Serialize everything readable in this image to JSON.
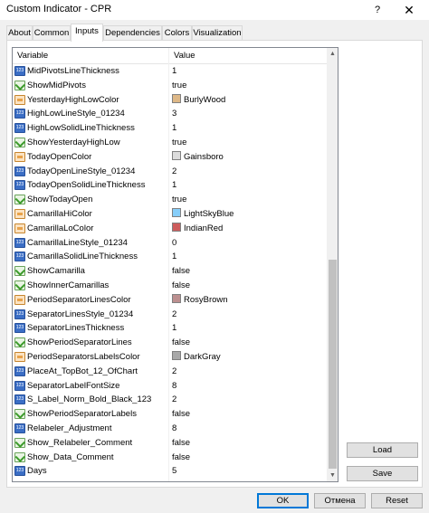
{
  "window": {
    "title": "Custom Indicator - CPR",
    "help_label": "?",
    "close_label": "✕"
  },
  "tabs": [
    {
      "label": "About"
    },
    {
      "label": "Common"
    },
    {
      "label": "Inputs",
      "active": true
    },
    {
      "label": "Dependencies"
    },
    {
      "label": "Colors"
    },
    {
      "label": "Visualization"
    }
  ],
  "grid": {
    "columns": [
      "Variable",
      "Value"
    ],
    "rows": [
      {
        "icon": "num-icon",
        "name": "MidPivotsLineThickness",
        "value": "1"
      },
      {
        "icon": "bool-icon",
        "name": "ShowMidPivots",
        "value": "true"
      },
      {
        "icon": "color-icon",
        "name": "YesterdayHighLowColor",
        "value": "BurlyWood",
        "swatch": "#deb887"
      },
      {
        "icon": "num-icon",
        "name": "HighLowLineStyle_01234",
        "value": "3"
      },
      {
        "icon": "num-icon",
        "name": "HighLowSolidLineThickness",
        "value": "1"
      },
      {
        "icon": "bool-icon",
        "name": "ShowYesterdayHighLow",
        "value": "true"
      },
      {
        "icon": "color-icon",
        "name": "TodayOpenColor",
        "value": "Gainsboro",
        "swatch": "#dcdcdc"
      },
      {
        "icon": "num-icon",
        "name": "TodayOpenLineStyle_01234",
        "value": "2"
      },
      {
        "icon": "num-icon",
        "name": "TodayOpenSolidLineThickness",
        "value": "1"
      },
      {
        "icon": "bool-icon",
        "name": "ShowTodayOpen",
        "value": "true"
      },
      {
        "icon": "color-icon",
        "name": "CamarillaHiColor",
        "value": "LightSkyBlue",
        "swatch": "#87cefa"
      },
      {
        "icon": "color-icon",
        "name": "CamarillaLoColor",
        "value": "IndianRed",
        "swatch": "#cd5c5c"
      },
      {
        "icon": "num-icon",
        "name": "CamarillaLineStyle_01234",
        "value": "0"
      },
      {
        "icon": "num-icon",
        "name": "CamarillaSolidLineThickness",
        "value": "1"
      },
      {
        "icon": "bool-icon",
        "name": "ShowCamarilla",
        "value": "false"
      },
      {
        "icon": "bool-icon",
        "name": "ShowInnerCamarillas",
        "value": "false"
      },
      {
        "icon": "color-icon",
        "name": "PeriodSeparatorLinesColor",
        "value": "RosyBrown",
        "swatch": "#bc8f8f"
      },
      {
        "icon": "num-icon",
        "name": "SeparatorLinesStyle_01234",
        "value": "2"
      },
      {
        "icon": "num-icon",
        "name": "SeparatorLinesThickness",
        "value": "1"
      },
      {
        "icon": "bool-icon",
        "name": "ShowPeriodSeparatorLines",
        "value": "false"
      },
      {
        "icon": "color-icon",
        "name": "PeriodSeparatorsLabelsColor",
        "value": "DarkGray",
        "swatch": "#a9a9a9"
      },
      {
        "icon": "num-icon",
        "name": "PlaceAt_TopBot_12_OfChart",
        "value": "2"
      },
      {
        "icon": "num-icon",
        "name": "SeparatorLabelFontSize",
        "value": "8"
      },
      {
        "icon": "num-icon",
        "name": "S_Label_Norm_Bold_Black_123",
        "value": "2"
      },
      {
        "icon": "bool-icon",
        "name": "ShowPeriodSeparatorLabels",
        "value": "false"
      },
      {
        "icon": "num-icon",
        "name": "Relabeler_Adjustment",
        "value": "8"
      },
      {
        "icon": "bool-icon",
        "name": "Show_Relabeler_Comment",
        "value": "false"
      },
      {
        "icon": "bool-icon",
        "name": "Show_Data_Comment",
        "value": "false"
      },
      {
        "icon": "num-icon",
        "name": "Days",
        "value": "5"
      }
    ]
  },
  "buttons": {
    "load": "Load",
    "save": "Save",
    "ok": "OK",
    "cancel": "Отмена",
    "reset": "Reset"
  }
}
